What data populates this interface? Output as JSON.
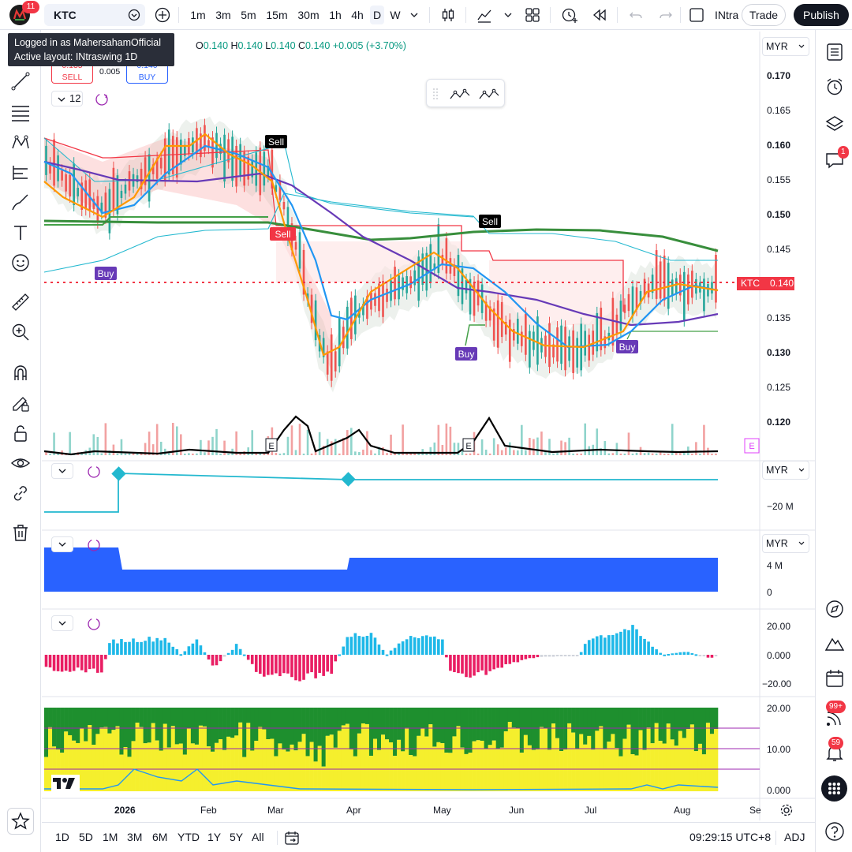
{
  "topbar": {
    "notification_count": "11",
    "symbol": "KTC",
    "intervals": [
      "1m",
      "3m",
      "5m",
      "15m",
      "30m",
      "1h",
      "4h",
      "D",
      "W"
    ],
    "active_interval": "D",
    "layout_name": "INtra",
    "trade_label": "Trade",
    "publish_label": "Publish"
  },
  "tooltip": {
    "line1": "Logged in as MahersahamOfficial",
    "line2": "Active layout: INtraswing 1D"
  },
  "legend": {
    "o_label": "O",
    "o_value": "0.140",
    "h_label": "H",
    "h_value": "0.140",
    "l_label": "L",
    "l_value": "0.140",
    "c_label": "C",
    "c_value": "0.140",
    "change": "+0.005 (+3.70%)",
    "sell_price": "0.135",
    "sell_label": "SELL",
    "spread": "0.005",
    "buy_price": "0.140",
    "buy_label": "BUY",
    "indicator_count": "12"
  },
  "currency": "MYR",
  "price_axis": [
    "0.170",
    "0.165",
    "0.160",
    "0.155",
    "0.150",
    "0.145",
    "0.135",
    "0.130",
    "0.125",
    "0.120"
  ],
  "price_tag": {
    "symbol": "KTC",
    "value": "0.140"
  },
  "pane2_axis": [
    "−20 M"
  ],
  "pane3_axis": [
    "4 M",
    "0"
  ],
  "pane4_axis": [
    "20.00",
    "0.000",
    "−20.00"
  ],
  "pane5_axis": [
    "20.00",
    "10.00",
    "0.000"
  ],
  "time_axis": [
    "2026",
    "Feb",
    "Mar",
    "Apr",
    "May",
    "Jun",
    "Jul",
    "Aug",
    "Se"
  ],
  "signals": {
    "buy": "Buy",
    "sell": "Sell",
    "earnings": "E"
  },
  "rightbar": {
    "chat_badge": "1",
    "stream_badge": "99+",
    "alerts_badge": "59"
  },
  "bottombar": {
    "ranges": [
      "1D",
      "5D",
      "1M",
      "3M",
      "6M",
      "YTD",
      "1Y",
      "5Y",
      "All"
    ],
    "clock": "09:29:15 UTC+8",
    "adj": "ADJ"
  },
  "colors": {
    "up": "#26a69a",
    "down": "#ef5350",
    "accent": "#2962ff",
    "cyan": "#22b8cf",
    "purple": "#673ab7",
    "orange": "#ff9800",
    "blue": "#2196f3",
    "green": "#388e3c",
    "magenta": "#e91e63"
  }
}
